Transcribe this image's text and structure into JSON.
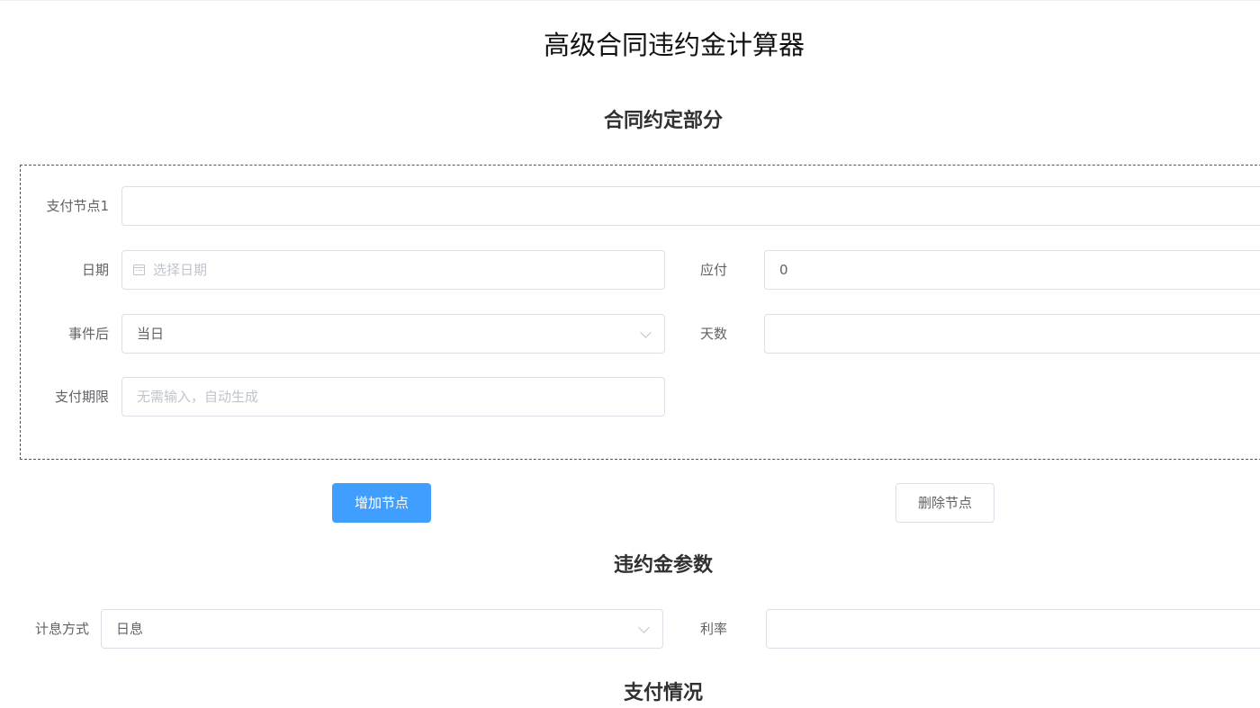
{
  "page": {
    "title": "高级合同违约金计算器"
  },
  "contract_section": {
    "title": "合同约定部分",
    "node": {
      "name_label": "支付节点1",
      "name_value": "",
      "date_label": "日期",
      "date_placeholder": "选择日期",
      "payable_label": "应付",
      "payable_value": "0",
      "event_after_label": "事件后",
      "event_after_value": "当日",
      "days_label": "天数",
      "days_value": "",
      "deadline_label": "支付期限",
      "deadline_placeholder": "无需输入，自动生成"
    },
    "add_button": "增加节点",
    "delete_button": "删除节点"
  },
  "penalty_section": {
    "title": "违约金参数",
    "interest_method_label": "计息方式",
    "interest_method_value": "日息",
    "rate_label": "利率",
    "rate_value": ""
  },
  "payment_section": {
    "title": "支付情况"
  },
  "icons": {
    "date": "calendar-icon",
    "select": "chevron-down-icon"
  }
}
